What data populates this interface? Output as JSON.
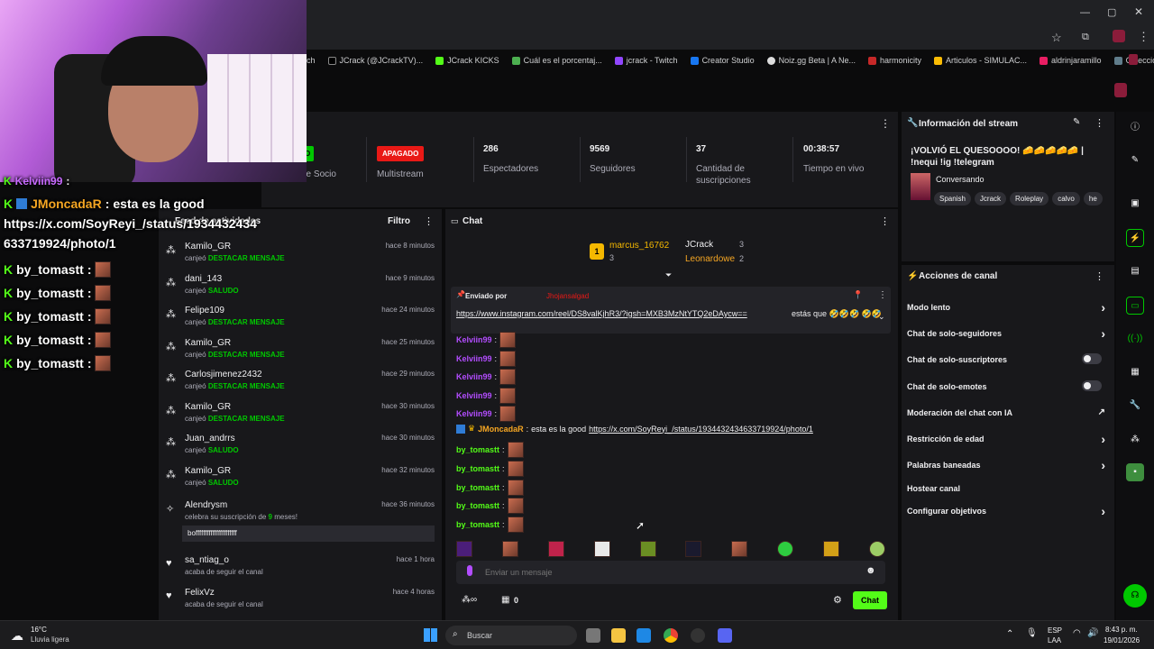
{
  "browser": {
    "bookmarks": [
      "ch",
      "JCrack (@JCrackTV)...",
      "JCrack KICKS",
      "Cuál es el porcentaj...",
      "jcrack - Twitch",
      "Creator Studio",
      "Noiz.gg Beta | A Ne...",
      "harmonicity",
      "Articulos - SIMULAC...",
      "aldrinjaramillo",
      "Colección de M_blei..."
    ]
  },
  "stats": {
    "socio_badge": "O",
    "socio_label": "de Socio",
    "multistream_badge": "APAGADO",
    "multistream_label": "Multistream",
    "viewers_value": "286",
    "viewers_label": "Espectadores",
    "followers_value": "9569",
    "followers_label": "Seguidores",
    "subs_value": "37",
    "subs_label": "Cantidad de suscripciones",
    "uptime_value": "00:38:57",
    "uptime_label": "Tiempo en vivo"
  },
  "stream_info": {
    "header": "Información del stream",
    "title": "¡VOLVIÓ EL QUESOOOO! 🧀🧀🧀🧀🧀 | !nequi !ig !telegram",
    "category": "Conversando",
    "tags": [
      "Spanish",
      "Jcrack",
      "Roleplay",
      "calvo",
      "he"
    ]
  },
  "channel_actions": {
    "header": "Acciones de canal",
    "items": [
      "Modo lento",
      "Chat de solo-seguidores",
      "Chat de solo-suscriptores",
      "Chat de solo-emotes",
      "Moderación del chat con IA",
      "Restricción de edad",
      "Palabras baneadas",
      "Hostear canal",
      "Configurar objetivos"
    ]
  },
  "feed": {
    "header": "Feed de actividades",
    "filter_label": "Filtro",
    "items": [
      {
        "name": "Kamilo_GR",
        "time": "hace 8 minutos",
        "action": "canjeó",
        "reward": "DESTACAR MENSAJE"
      },
      {
        "name": "dani_143",
        "time": "hace 9 minutos",
        "action": "canjeó",
        "reward": "SALUDO"
      },
      {
        "name": "Felipe109",
        "time": "hace 24 minutos",
        "action": "canjeó",
        "reward": "DESTACAR MENSAJE"
      },
      {
        "name": "Kamilo_GR",
        "time": "hace 25 minutos",
        "action": "canjeó",
        "reward": "DESTACAR MENSAJE"
      },
      {
        "name": "Carlosjimenez2432",
        "time": "hace 29 minutos",
        "action": "canjeó",
        "reward": "DESTACAR MENSAJE"
      },
      {
        "name": "Kamilo_GR",
        "time": "hace 30 minutos",
        "action": "canjeó",
        "reward": "DESTACAR MENSAJE"
      },
      {
        "name": "Juan_andrrs",
        "time": "hace 30 minutos",
        "action": "canjeó",
        "reward": "SALUDO"
      },
      {
        "name": "Kamilo_GR",
        "time": "hace 32 minutos",
        "action": "canjeó",
        "reward": "SALUDO"
      }
    ],
    "sub_item": {
      "name": "Alendrysm",
      "time": "hace 36 minutos",
      "text_pre": "celebra su suscripción de",
      "months": "9",
      "text_post": "meses!",
      "message": "boffffffffffffffffffffff"
    },
    "follows": [
      {
        "name": "sa_ntiag_o",
        "time": "hace 1 hora",
        "text": "acaba de seguir el canal"
      },
      {
        "name": "FelixVz",
        "time": "hace 4 horas",
        "text": "acaba de seguir el canal"
      }
    ]
  },
  "chat": {
    "header": "Chat",
    "leaders": [
      {
        "rank": "1",
        "name": "marcus_16762",
        "count": "3"
      },
      {
        "name": "JCrack",
        "count": "3"
      },
      {
        "name": "Leonardowe",
        "count": "2"
      }
    ],
    "pinned_by_label": "Enviado por",
    "pinned_user": "Jhojansalgad",
    "pinned_link": "https://www.instagram.com/reel/DS8valKjhR3/?igsh=MXB3MzNtYTQ2eDAycw==",
    "pinned_text": "estás que 🤣🤣🤣 🤣🤣",
    "messages": [
      {
        "user": "Kelviin99"
      },
      {
        "user": "Kelviin99"
      },
      {
        "user": "Kelviin99"
      },
      {
        "user": "Kelviin99"
      },
      {
        "user": "Kelviin99"
      }
    ],
    "moncada": {
      "user": "JMoncadaR",
      "text": "esta es la good",
      "link": "https://x.com/SoyReyi_/status/1934432434633719924/photo/1"
    },
    "tomastt": [
      "by_tomastt",
      "by_tomastt",
      "by_tomastt",
      "by_tomastt",
      "by_tomastt"
    ],
    "input_placeholder": "Enviar un mensaje",
    "points_value": "0",
    "send_label": "Chat"
  },
  "overlay": {
    "line1_user": "Kelviin99",
    "line2_user": "JMoncadaR",
    "line2_text": "esta es la good",
    "line3": "https://x.com/SoyReyi_/status/1934432434",
    "line4": "633719924/photo/1",
    "tomastt": "by_tomastt"
  },
  "taskbar": {
    "temp": "16°C",
    "weather": "Lluvia ligera",
    "search": "Buscar",
    "lang1": "ESP",
    "lang2": "LAA",
    "time": "8:43 p. m.",
    "date": "19/01/2026"
  }
}
